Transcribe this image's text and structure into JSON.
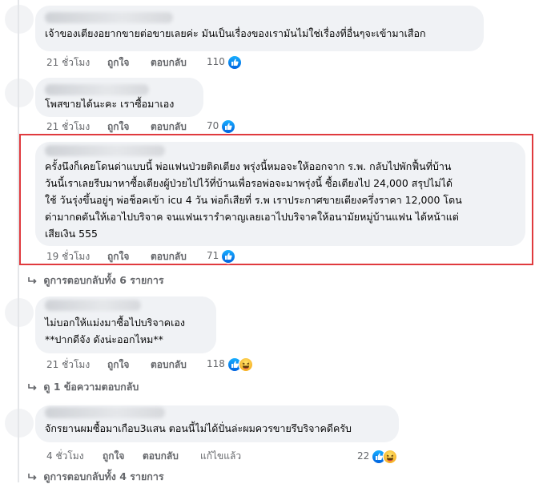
{
  "comments": [
    {
      "text": "เจ้าของเตียงอยากขายต่อขายเลยค่ะ มันเป็นเรื่องของเรามันไม่ใช่เรื่องที่อื่นๆจะเข้ามาเสือก",
      "time": "21 ชั่วโมง",
      "like_label": "ถูกใจ",
      "reply_label": "ตอบกลับ",
      "reaction_count": "110",
      "reactions": [
        "like-icon"
      ]
    },
    {
      "text": "โพสขายได้นะคะ เราซื้อมาเอง",
      "time": "21 ชั่วโมง",
      "like_label": "ถูกใจ",
      "reply_label": "ตอบกลับ",
      "reaction_count": "70",
      "reactions": [
        "like-icon"
      ]
    },
    {
      "text": "ครั้งนึงก็เคยโดนด่าแบบนี้ พ่อแฟนป่วยติดเตียง พรุ่งนี้หมอจะให้ออกจาก ร.พ. กลับไปพักฟื้นที่บ้าน วันนี้เราเลยรีบมาหาซื้อเตียงผู้ป่วยไปไว้ที่บ้านเพื่อรอพ่อจะมาพรุ่งนี้ ซื้อเตียงไป 24,000 สรุปไม่ได้ใช้ วันรุ่งขึ้นอยู่ๆ พ่อช็อคเข้า icu 4 วัน พ่อก็เสียที่ ร.พ เราประกาศขายเตียงครึ่งราคา 12,000 โดนด่ามากดดันให้เอาไปบริจาค จนแฟนเรารำคาญเลยเอาไปบริจาคให้อนามัยหมู่บ้านแฟน ได้หน้าแต่เสียเงิน 555",
      "line1": "ครั้งนึงก็เคยโดนด่าแบบนี้ พ่อแฟนป่วยติดเตียง พรุ่งนี้หมอจะให้ออกจาก ร.พ. กลับไปพักฟื้นที่บ้าน",
      "line2": "วันนี้เราเลยรีบมาหาซื้อเตียงผู้ป่วยไปไว้ที่บ้านเพื่อรอพ่อจะมาพรุ่งนี้ ซื้อเตียงไป 24,000 สรุปไม่ได้",
      "line3": "ใช้ วันรุ่งขึ้นอยู่ๆ พ่อช็อคเข้า icu 4 วัน พ่อก็เสียที่ ร.พ เราประกาศขายเตียงครึ่งราคา 12,000 โดน",
      "line4": "ด่ามากดดันให้เอาไปบริจาค จนแฟนเรารำคาญเลยเอาไปบริจาคให้อนามัยหมู่บ้านแฟน ได้หน้าแต่",
      "line5": "เสียเงิน 555",
      "time": "19 ชั่วโมง",
      "like_label": "ถูกใจ",
      "reply_label": "ตอบกลับ",
      "reaction_count": "71",
      "reactions": [
        "like-icon"
      ],
      "view_replies": "ดูการตอบกลับทั้ง 6 รายการ"
    },
    {
      "line1": "ไม่บอกให้แม่งมาซื้อไปบริจาคเอง",
      "line2": "**ปากดีจัง ดังน่ะออกไหม**",
      "time": "21 ชั่วโมง",
      "like_label": "ถูกใจ",
      "reply_label": "ตอบกลับ",
      "reaction_count": "118",
      "reactions": [
        "like-icon",
        "haha-icon"
      ],
      "view_replies": "ดู 1 ข้อความตอบกลับ"
    },
    {
      "text": "จักรยานผมซื้อมาเกือบ3แสน ตอนนี้ไม่ได้ปั่นล่ะผมควรขายรึบริจาคดีครับ",
      "time": "4 ชั่วโมง",
      "like_label": "ถูกใจ",
      "reply_label": "ตอบกลับ",
      "edited_label": "แก้ไขแล้ว",
      "reaction_count": "22",
      "reactions": [
        "like-icon",
        "haha-icon"
      ],
      "view_replies": "ดูการตอบกลับทั้ง 4 รายการ"
    }
  ],
  "colors": {
    "bubble": "#f0f2f5",
    "meta_text": "#65676b",
    "highlight_border": "#e03a3e",
    "like_blue": "#0866ff"
  }
}
